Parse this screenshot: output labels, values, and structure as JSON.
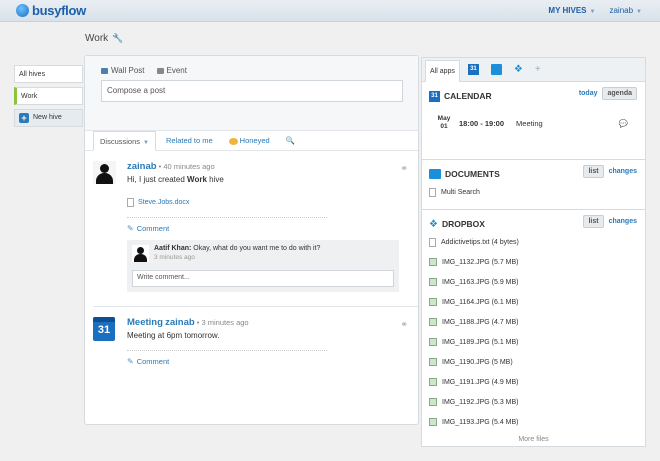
{
  "header": {
    "brand": "busyflow",
    "hives_menu": "MY HIVES",
    "user": "zainab"
  },
  "page": {
    "title": "Work"
  },
  "hive_nav": {
    "items": [
      "All hives",
      "Work"
    ],
    "new_hive": "New hive"
  },
  "composer": {
    "tabs": [
      "Wall Post",
      "Event"
    ],
    "placeholder": "Compose a post"
  },
  "filters": {
    "discussions": "Discussions",
    "related": "Related to me",
    "honeyed": "Honeyed"
  },
  "posts": [
    {
      "author": "zainab",
      "time": "40 minutes ago",
      "text_prefix": "Hi, I just created ",
      "text_bold": "Work",
      "text_suffix": " hive",
      "attachment": "Steve.Jobs.docx",
      "comment_label": "Comment",
      "comment": {
        "author": "Aatif Khan:",
        "text": "Okay, what do you want me to do with it?",
        "time": "3 minutes ago"
      },
      "write_placeholder": "Write comment..."
    },
    {
      "title": "Meeting",
      "author": "zainab",
      "time": "3 minutes ago",
      "text": "Meeting at 6pm tomorrow.",
      "comment_label": "Comment",
      "cal_day": "31"
    }
  ],
  "apps": {
    "tabs": {
      "all": "All apps",
      "cal_day": "31"
    },
    "calendar": {
      "title": "CALENDAR",
      "today": "today",
      "agenda": "agenda",
      "event": {
        "month": "May",
        "day": "01",
        "time": "18:00 - 19:00",
        "title": "Meeting"
      }
    },
    "documents": {
      "title": "DOCUMENTS",
      "list": "list",
      "changes": "changes",
      "files": [
        "Multi Search"
      ]
    },
    "dropbox": {
      "title": "DROPBOX",
      "list": "list",
      "changes": "changes",
      "files": [
        "Addictivetips.txt (4 bytes)",
        "IMG_1132.JPG (5.7 MB)",
        "IMG_1163.JPG (5.9 MB)",
        "IMG_1164.JPG (6.1 MB)",
        "IMG_1188.JPG (4.7 MB)",
        "IMG_1189.JPG (5.1 MB)",
        "IMG_1190.JPG (5 MB)",
        "IMG_1191.JPG (4.9 MB)",
        "IMG_1192.JPG (5.3 MB)",
        "IMG_1193.JPG (5.4 MB)"
      ],
      "more": "More files"
    }
  }
}
